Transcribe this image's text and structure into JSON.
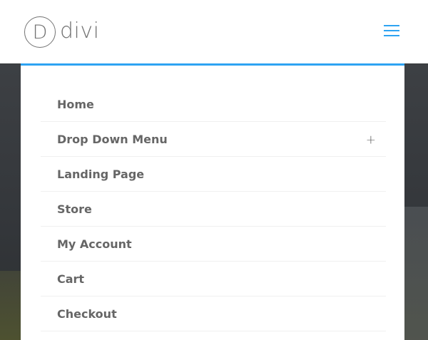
{
  "header": {
    "logo_mark": "D",
    "logo_text": "divi",
    "menu_icon": "hamburger-menu-icon"
  },
  "colors": {
    "accent": "#2ea3f2",
    "text": "#666666",
    "logo": "#737373"
  },
  "menu": {
    "items": [
      {
        "label": "Home",
        "has_children": false
      },
      {
        "label": "Drop Down Menu",
        "has_children": true,
        "expand_symbol": "+"
      },
      {
        "label": "Landing Page",
        "has_children": false
      },
      {
        "label": "Store",
        "has_children": false
      },
      {
        "label": "My Account",
        "has_children": false
      },
      {
        "label": "Cart",
        "has_children": false
      },
      {
        "label": "Checkout",
        "has_children": false
      }
    ]
  }
}
